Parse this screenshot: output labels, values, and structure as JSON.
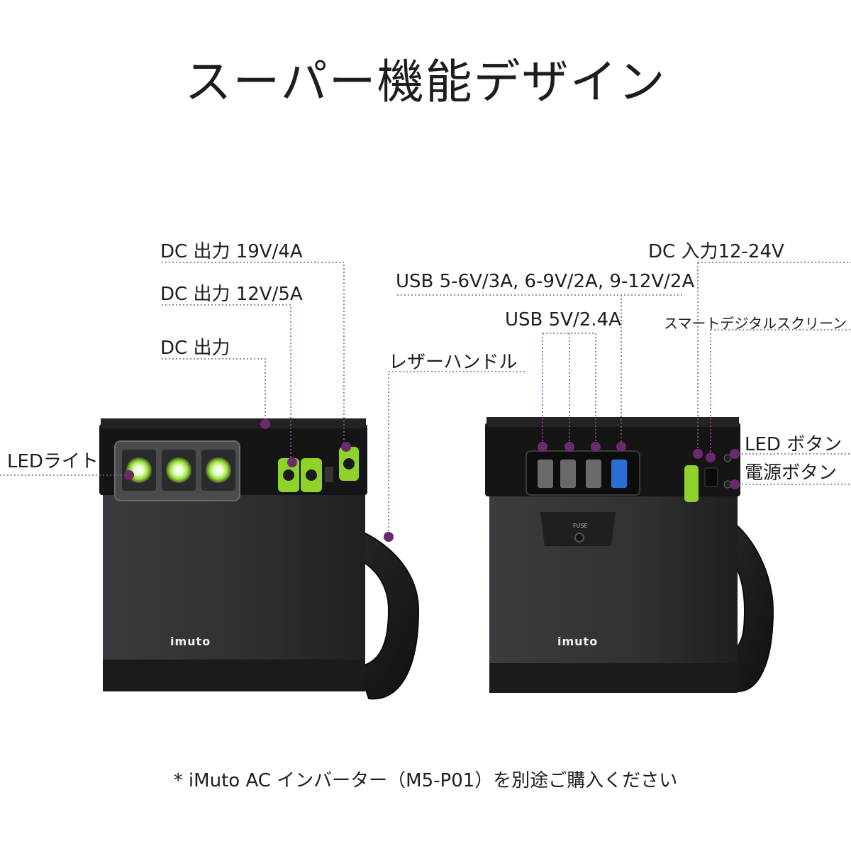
{
  "title": "スーパー機能デザイン",
  "callouts": {
    "dc_out_19v": "DC 出力 19V/4A",
    "dc_out_12v": "DC 出力 12V/5A",
    "dc_out": "DC 出力",
    "led_light": "LEDライト",
    "leather_handle": "レザーハンドル",
    "usb_qc": "USB 5-6V/3A, 6-9V/2A, 9-12V/2A",
    "usb_5v": "USB 5V/2.4A",
    "dc_in": "DC 入力12-24V",
    "smart_screen": "スマートデジタルスクリーン",
    "led_button": "LED ボタン",
    "power_button": "電源ボタン"
  },
  "device": {
    "brand_left": "imuto",
    "brand_right": "imuto",
    "fuse_label": "FUSE"
  },
  "footnote": "* iMuto AC インバーター（M5-P01）を別途ご購入ください",
  "colors": {
    "callout_dot": "#6b2a6e",
    "port_green": "#8fd22a",
    "body_dark": "#2e2f31"
  }
}
